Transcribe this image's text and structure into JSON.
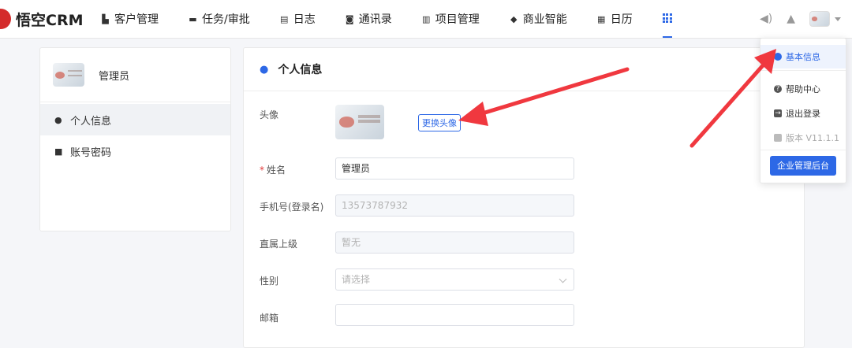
{
  "logo": {
    "text": "悟空CRM"
  },
  "nav": [
    {
      "label": "客户管理",
      "icon": "bar-chart-icon"
    },
    {
      "label": "任务/审批",
      "icon": "briefcase-icon"
    },
    {
      "label": "日志",
      "icon": "notebook-icon"
    },
    {
      "label": "通讯录",
      "icon": "contacts-icon"
    },
    {
      "label": "项目管理",
      "icon": "kanban-icon"
    },
    {
      "label": "商业智能",
      "icon": "shield-check-icon"
    },
    {
      "label": "日历",
      "icon": "calendar-icon"
    }
  ],
  "sidebar": {
    "profile_name": "管理员",
    "items": [
      {
        "label": "个人信息",
        "icon": "user-icon"
      },
      {
        "label": "账号密码",
        "icon": "lock-icon"
      }
    ]
  },
  "main": {
    "title": "个人信息",
    "avatar_label": "头像",
    "change_avatar": "更换头像",
    "fields": [
      {
        "label": "姓名",
        "required": "*",
        "value": "管理员"
      },
      {
        "label": "手机号(登录名)",
        "value": "13573787932"
      },
      {
        "label": "直属上级",
        "value": "暂无"
      },
      {
        "label": "性别",
        "placeholder": "请选择"
      },
      {
        "label": "邮箱",
        "value": ""
      }
    ]
  },
  "dropdown": {
    "basic_info": "基本信息",
    "help": "帮助中心",
    "logout": "退出登录",
    "version": "版本 V11.1.1",
    "admin_button": "企业管理后台"
  },
  "colors": {
    "accent": "#2d68e6",
    "arrow": "#f0383f",
    "brand_red": "#d42b2b"
  }
}
